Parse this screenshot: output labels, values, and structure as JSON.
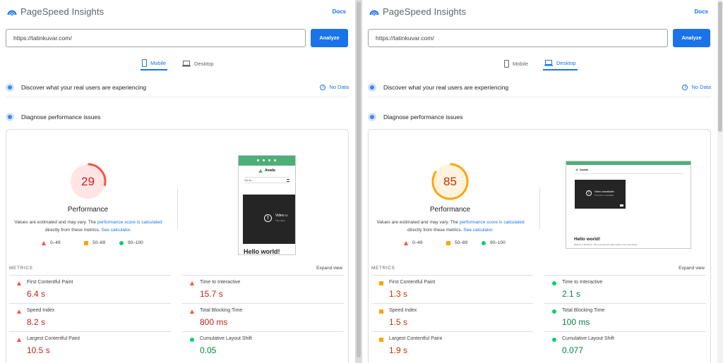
{
  "colors": {
    "accent": "#1a73e8",
    "fail": "#ff4e42",
    "fail_text": "#c5221f",
    "average": "#ffa400",
    "average_text": "#c33300",
    "pass": "#0cce6b",
    "pass_text": "#018642"
  },
  "left": {
    "brand": "PageSpeed Insights",
    "docs": "Docs",
    "url_value": "https://tatinkuvar.com/",
    "analyze": "Analyze",
    "tabs": [
      {
        "label": "Mobile",
        "active": true,
        "icon": "phone-icon"
      },
      {
        "label": "Desktop",
        "active": false,
        "icon": "laptop-icon"
      }
    ],
    "real_users": "Discover what your real users are experiencing",
    "no_data": "No Data",
    "diagnose": "Diagnose performance issues",
    "score": "29",
    "score_fraction": 0.29,
    "score_status": "fail",
    "performance": "Performance",
    "note_pre": "Values are estimated and may vary. The ",
    "note_link1": "performance score is calculated",
    "note_mid": " directly from these metrics. ",
    "note_link2": "See calculator.",
    "legend": [
      "0–49",
      "50–89",
      "90–100"
    ],
    "metrics_label": "METRICS",
    "expand": "Expand view",
    "metrics": [
      {
        "name": "First Contentful Paint",
        "value": "6.4 s",
        "status": "fail"
      },
      {
        "name": "Time to Interactive",
        "value": "15.7 s",
        "status": "fail"
      },
      {
        "name": "Speed Index",
        "value": "8.2 s",
        "status": "fail"
      },
      {
        "name": "Total Blocking Time",
        "value": "800 ms",
        "status": "fail"
      },
      {
        "name": "Largest Contentful Paint",
        "value": "10.5 s",
        "status": "fail"
      },
      {
        "name": "Cumulative Layout Shift",
        "value": "0.05",
        "status": "pass"
      }
    ],
    "shot": {
      "brand": "Avada",
      "menu": "Go to...",
      "video": "Video u",
      "video_sub": "This video",
      "hello": "Hello world!"
    }
  },
  "right": {
    "brand": "PageSpeed Insights",
    "docs": "Docs",
    "url_value": "https://tatinkuvar.com/",
    "analyze": "Analyze",
    "tabs": [
      {
        "label": "Mobile",
        "active": false,
        "icon": "phone-icon"
      },
      {
        "label": "Desktop",
        "active": true,
        "icon": "laptop-icon"
      }
    ],
    "real_users": "Discover what your real users are experiencing",
    "no_data": "No Data",
    "diagnose": "Diagnose performance issues",
    "score": "85",
    "score_fraction": 0.85,
    "score_status": "average",
    "performance": "Performance",
    "note_pre": "Values are estimated and may vary. The ",
    "note_link1": "performance score is calculated",
    "note_mid": " directly from these metrics. ",
    "note_link2": "See calculator.",
    "legend": [
      "0–49",
      "50–89",
      "90–100"
    ],
    "metrics_label": "METRICS",
    "expand": "Expand view",
    "metrics": [
      {
        "name": "First Contentful Paint",
        "value": "1.3 s",
        "status": "average"
      },
      {
        "name": "Time to Interactive",
        "value": "2.1 s",
        "status": "pass"
      },
      {
        "name": "Speed Index",
        "value": "1.5 s",
        "status": "average"
      },
      {
        "name": "Total Blocking Time",
        "value": "100 ms",
        "status": "pass"
      },
      {
        "name": "Largest Contentful Paint",
        "value": "1.9 s",
        "status": "average"
      },
      {
        "name": "Cumulative Layout Shift",
        "value": "0.077",
        "status": "pass"
      }
    ],
    "shot": {
      "brand": "Avada",
      "video": "Video unavailable",
      "video_sub": "This video is unavailable",
      "hello": "Hello world!",
      "body": "Welcome to WordPress. This is your first post. Edit or delete it, then start writing!"
    }
  }
}
